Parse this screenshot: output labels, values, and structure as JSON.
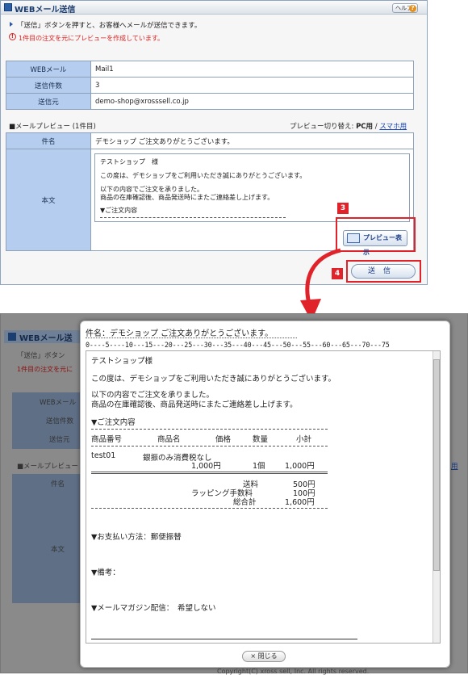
{
  "top": {
    "title": "WEBメール送信",
    "help": "ヘルプ",
    "help_q": "?",
    "instruction": "「送信」ボタンを押すと、お客様へメールが送信できます。",
    "warning": "1件目の注文を元にプレビューを作成しています。",
    "rows": [
      {
        "label": "WEBメール",
        "value": "Mail1"
      },
      {
        "label": "送信件数",
        "value": "3"
      },
      {
        "label": "送信元",
        "value": "demo-shop@xrosssell.co.jp"
      }
    ],
    "preview_heading": "■メールプレビュー (1件目)",
    "preview_switch_label": "プレビュー切り替え:",
    "preview_pc": "PC用",
    "preview_sep": "/",
    "preview_sp": "スマホ用",
    "subject_label": "件名",
    "subject_value": "デモショップ ご注文ありがとうございます。",
    "body_label": "本文",
    "body_lines": [
      "テストショップ　様",
      "この度は、デモショップをご利用いただき誠にありがとうございます。",
      "以下の内容でご注文を承りました。",
      "商品の在庫確認後、商品発送時にまたご連絡差し上げます。",
      "▼ご注文内容"
    ],
    "preview_button": "プレビュー表示",
    "send_button": "送信",
    "step3": "3",
    "step4": "4"
  },
  "bottom_bg": {
    "title": "WEBメール送",
    "instruction": "「送信」ボタン",
    "warning": "1件目の注文を元に",
    "rows": [
      "WEBメール",
      "送信件数",
      "送信元"
    ],
    "preview_heading": "■メールプレビュー",
    "subject_label": "件名",
    "body_label": "本文",
    "link_fragment": "用",
    "footer": "Copyright(C) xross sell, Inc. All rights reserved."
  },
  "modal": {
    "subject": "件名：デモショップ ご注文ありがとうございます。",
    "ruler": "0----5----10---15---20---25---30---35---40---45---50---55---60---65---70---75",
    "lines": [
      "テストショップ様",
      "この度は、デモショップをご利用いただき誠にありがとうございます。",
      "以下の内容でご注文を承りました。",
      "商品の在庫確認後、商品発送時にまたご連絡差し上げます。",
      "▼ご注文内容"
    ],
    "table_header": [
      "商品番号",
      "商品名",
      "価格",
      "数量",
      "小計"
    ],
    "item": {
      "code": "test01",
      "name": "銀振のみ消費税なし",
      "price": "1,000円",
      "qty": "1個",
      "subtotal": "1,000円"
    },
    "totals": [
      {
        "label": "送料",
        "value": "500円"
      },
      {
        "label": "ラッピング手数料",
        "value": "100円"
      },
      {
        "label": "総合計",
        "value": "1,600円"
      }
    ],
    "payment": "▼お支払い方法：郵便振替",
    "remarks": "▼備考：",
    "magazine": "▼メールマガジン配信：　希望しない",
    "close": "閉じる",
    "close_icon": "×"
  },
  "colors": {
    "accent_red": "#e0232a",
    "header_blue": "#b5cdee"
  }
}
